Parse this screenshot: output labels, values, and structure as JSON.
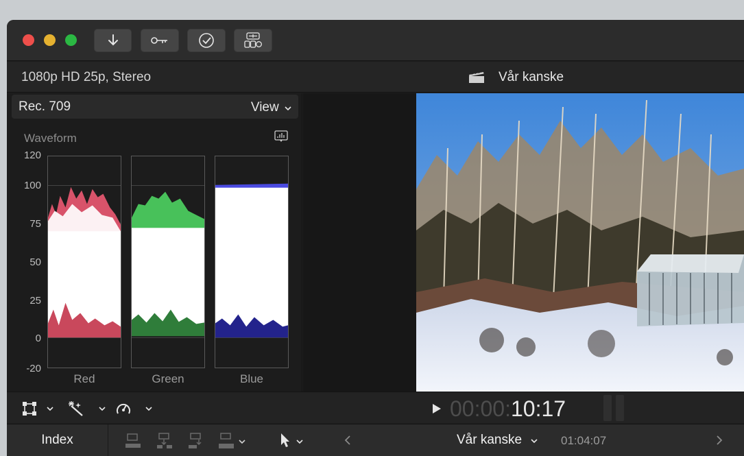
{
  "window": {
    "toolbar": {
      "import_icon": "down-arrow-icon",
      "keywords_icon": "key-icon",
      "analysis_icon": "checkmark-circle-icon",
      "background_tasks_icon": "background-tasks-icon"
    }
  },
  "info_bar": {
    "format": "1080p HD 25p, Stereo",
    "project_title": "Vår kanske"
  },
  "scopes": {
    "color_space": "Rec. 709",
    "view_label": "View",
    "scope_type": "Waveform",
    "y_ticks": [
      "120",
      "100",
      "75",
      "50",
      "25",
      "0",
      "-20"
    ],
    "channels": [
      {
        "name": "Red",
        "color": "#e05a6a"
      },
      {
        "name": "Green",
        "color": "#5ed36b"
      },
      {
        "name": "Blue",
        "color": "#5a5aff"
      }
    ]
  },
  "viewer": {
    "timecode_dim": "00:00:",
    "timecode_main": "10:17"
  },
  "timeline": {
    "index_label": "Index",
    "project_name": "Vår kanske",
    "duration": "01:04:07"
  },
  "colors": {
    "close": "#ee4f4b",
    "minimize": "#e5b130",
    "maximize": "#2bb843"
  }
}
